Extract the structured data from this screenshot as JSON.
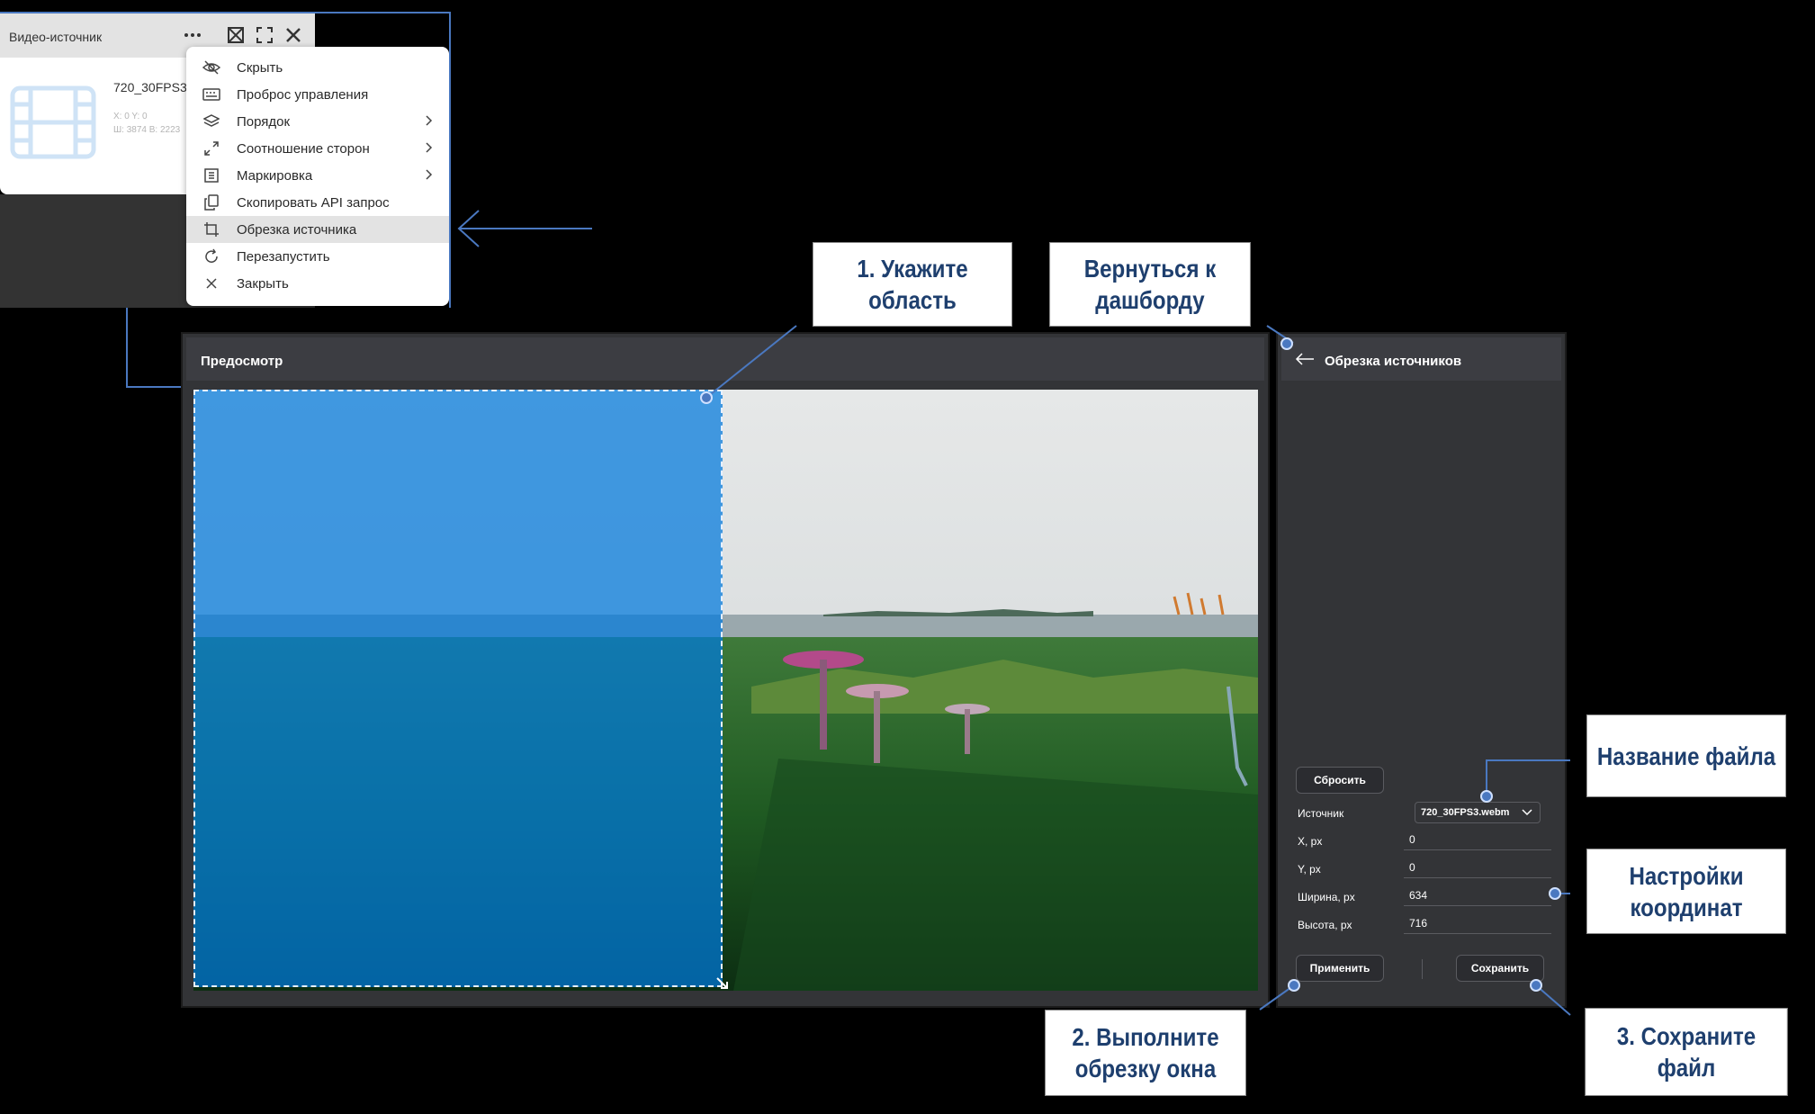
{
  "source_window": {
    "title": "Видео-источник",
    "file_name": "720_30FPS3",
    "position": "X: 0 Y: 0",
    "size": "Ш: 3874 В: 2223"
  },
  "context_menu": {
    "items": [
      {
        "label": "Скрыть",
        "icon": "eye-off-icon",
        "submenu": false
      },
      {
        "label": "Проброс управления",
        "icon": "keyboard-icon",
        "submenu": false
      },
      {
        "label": "Порядок",
        "icon": "layers-icon",
        "submenu": true
      },
      {
        "label": "Соотношение сторон",
        "icon": "expand-icon",
        "submenu": true
      },
      {
        "label": "Маркировка",
        "icon": "grid-icon",
        "submenu": true
      },
      {
        "label": "Скопировать API запрос",
        "icon": "copy-icon",
        "submenu": false
      },
      {
        "label": "Обрезка источника",
        "icon": "crop-icon",
        "submenu": false,
        "highlighted": true
      },
      {
        "label": "Перезапустить",
        "icon": "refresh-icon",
        "submenu": false
      },
      {
        "label": "Закрыть",
        "icon": "close-icon",
        "submenu": false
      }
    ]
  },
  "annotations": {
    "select_area": "1. Укажите область",
    "back_line1": "Вернуться к",
    "back_line2": "дашборду",
    "file_name": "Название файла",
    "coords_line1": "Настройки",
    "coords_line2": "координат",
    "crop_line1": "2. Выполните",
    "crop_line2": "обрезку окна",
    "save": "3. Сохраните файл"
  },
  "preview": {
    "title": "Предосмотр"
  },
  "crop_panel": {
    "title": "Обрезка источников",
    "reset_label": "Сбросить",
    "source_label": "Источник",
    "source_value": "720_30FPS3.webm",
    "x_label": "X, px",
    "x_value": "0",
    "y_label": "Y, px",
    "y_value": "0",
    "width_label": "Ширина, px",
    "width_value": "634",
    "height_label": "Высота, px",
    "height_value": "716",
    "apply_label": "Применить",
    "save_label": "Сохранить"
  },
  "colors": {
    "accent_blue": "#1e3f6e",
    "crop_overlay": "#0078dc",
    "panel_bg": "#333437",
    "line_blue": "#4a78c0"
  }
}
